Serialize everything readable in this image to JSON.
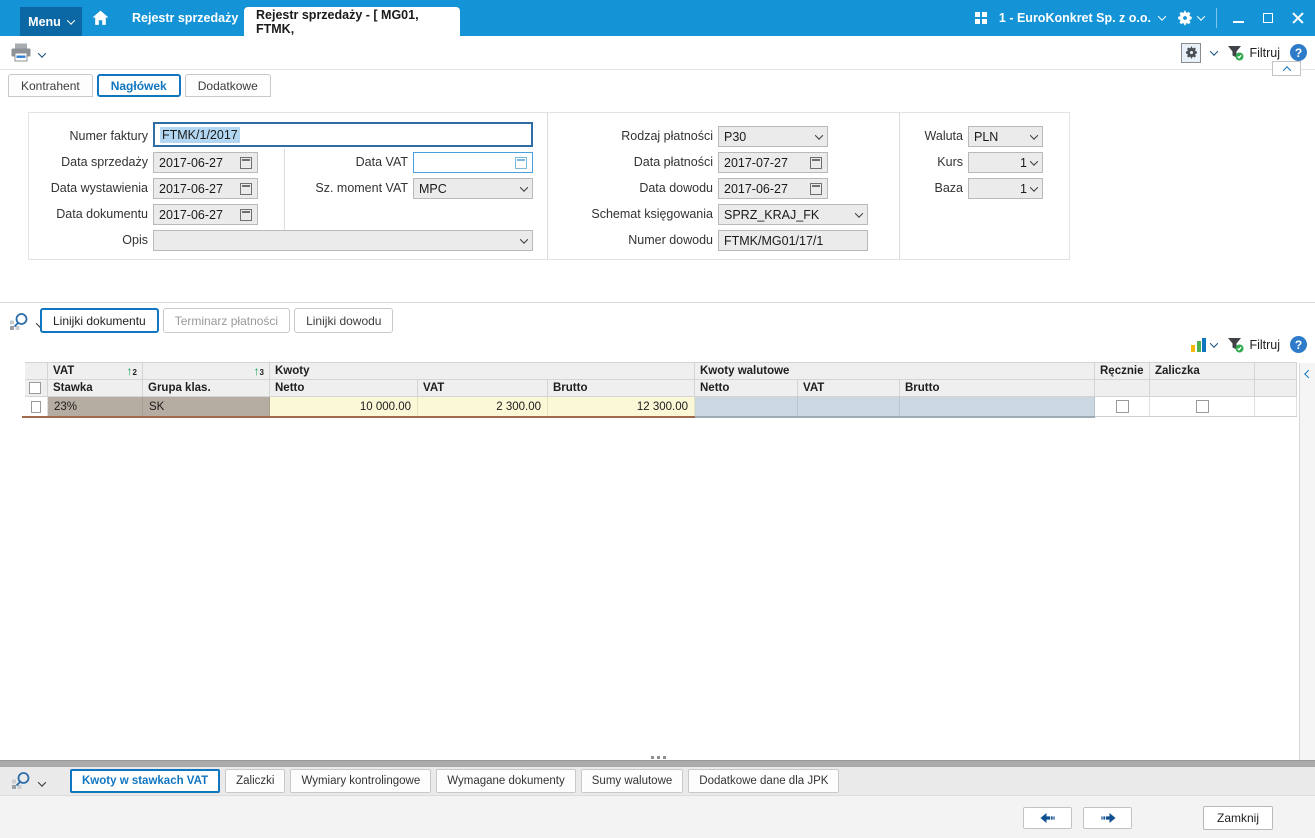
{
  "window": {
    "menu_label": "Menu",
    "doc_tab": "Rejestr sprzedaży",
    "active_doc_tab": "Rejestr sprzedaży - [ MG01, FTMK,",
    "company": "1 - EuroKonkret Sp. z o.o."
  },
  "toolbar": {
    "filter_label": "Filtruj",
    "help_glyph": "?"
  },
  "page_tabs": {
    "kontrahent": "Kontrahent",
    "naglowek": "Nagłówek",
    "dodatkowe": "Dodatkowe"
  },
  "form": {
    "numer_faktury": {
      "label": "Numer faktury",
      "value": "FTMK/1/2017"
    },
    "data_sprzedazy": {
      "label": "Data sprzedaży",
      "value": "2017-06-27"
    },
    "data_wystawienia": {
      "label": "Data wystawienia",
      "value": "2017-06-27"
    },
    "data_dokumentu": {
      "label": "Data dokumentu",
      "value": "2017-06-27"
    },
    "opis": {
      "label": "Opis",
      "value": ""
    },
    "data_vat": {
      "label": "Data VAT",
      "value": ""
    },
    "moment_vat": {
      "label": "Sz. moment VAT",
      "value": "MPC"
    },
    "rodzaj_platnosci": {
      "label": "Rodzaj płatności",
      "value": "P30"
    },
    "data_platnosci": {
      "label": "Data płatności",
      "value": "2017-07-27"
    },
    "data_dowodu": {
      "label": "Data dowodu",
      "value": "2017-06-27"
    },
    "schemat": {
      "label": "Schemat księgowania",
      "value": "SPRZ_KRAJ_FK"
    },
    "numer_dowodu": {
      "label": "Numer dowodu",
      "value": "FTMK/MG01/17/1"
    },
    "waluta": {
      "label": "Waluta",
      "value": "PLN"
    },
    "kurs": {
      "label": "Kurs",
      "value": "1"
    },
    "baza": {
      "label": "Baza",
      "value": "1"
    }
  },
  "middle": {
    "tab_linijki_dokumentu": "Linijki dokumentu",
    "tab_terminarz_platnosci": "Terminarz płatności",
    "tab_linijki_dowodu": "Linijki dowodu",
    "filter_label": "Filtruj",
    "help_glyph": "?"
  },
  "grid": {
    "group_vat": "VAT",
    "group_kwoty": "Kwoty",
    "group_kwoty_walutowe": "Kwoty walutowe",
    "col_recznie": "Ręcznie",
    "col_zaliczka": "Zaliczka",
    "col_stawka": "Stawka",
    "col_grupa_klas": "Grupa klas.",
    "col_netto": "Netto",
    "col_vat": "VAT",
    "col_brutto": "Brutto",
    "col_w_netto": "Netto",
    "col_w_vat": "VAT",
    "col_w_brutto": "Brutto",
    "sort_stawka_order": "2",
    "sort_grupa_order": "3",
    "row": {
      "stawka": "23%",
      "grupa_klas": "SK",
      "netto": "10 000.00",
      "vat": "2 300.00",
      "brutto": "12 300.00"
    }
  },
  "bottom_tabs": {
    "kwoty_w_stawkach_vat": "Kwoty w stawkach VAT",
    "zaliczki": "Zaliczki",
    "wymiary_kontrolingowe": "Wymiary kontrolingowe",
    "wymagane_dokumenty": "Wymagane dokumenty",
    "sumy_walutowe": "Sumy walutowe",
    "dodatkowe_dane_dla_jpk": "Dodatkowe dane dla JPK"
  },
  "footer": {
    "close_label": "Zamknij"
  },
  "colors": {
    "titlebar": "#1494d6",
    "menu_button": "#0b68a4",
    "accent": "#1076c0",
    "help_icon": "#2e7cc9",
    "row_readonly_tan": "#b6ada2",
    "row_amount_yellow": "#fbf8d7",
    "row_currency_gray": "#ccd8e1",
    "focus_border": "#4aa0dc",
    "row_focus_underline": "#a26a4c"
  }
}
